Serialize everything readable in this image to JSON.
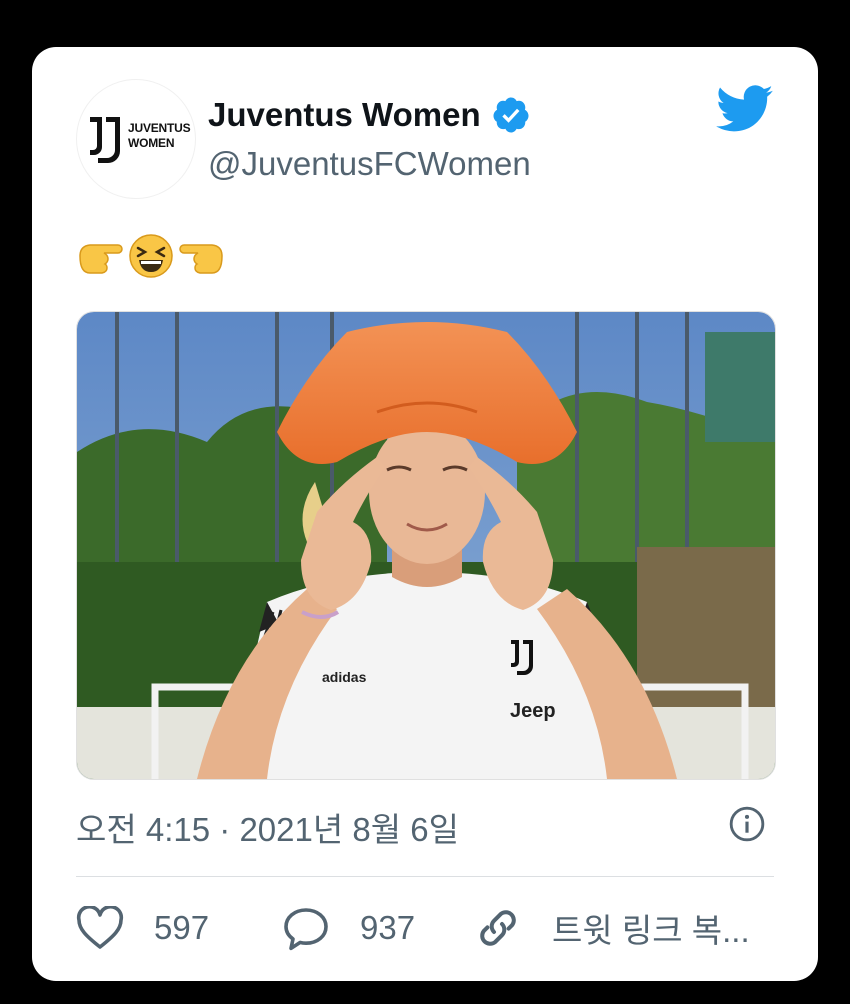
{
  "tweet": {
    "display_name": "Juventus Women",
    "handle": "@JuventusFCWomen",
    "avatar_text_line1": "JUVENTUS",
    "avatar_text_line2": "WOMEN",
    "emoji_text": "👉😆👈",
    "photo_text": {
      "brand": "adidas",
      "sponsor": "Jeep"
    },
    "timestamp": "오전 4:15 · 2021년 8월 6일"
  },
  "actions": {
    "likes": "597",
    "replies": "937",
    "copy_link": "트윗 링크 복..."
  },
  "colors": {
    "background": "#000000",
    "card": "#ffffff",
    "twitter_blue": "#1d9bf0",
    "text_primary": "#0f1419",
    "text_secondary": "#536471"
  },
  "icons": {
    "verified": "verified-badge-icon",
    "twitter": "twitter-bird-icon",
    "info": "info-icon",
    "like": "heart-icon",
    "reply": "speech-bubble-icon",
    "link": "link-icon"
  }
}
